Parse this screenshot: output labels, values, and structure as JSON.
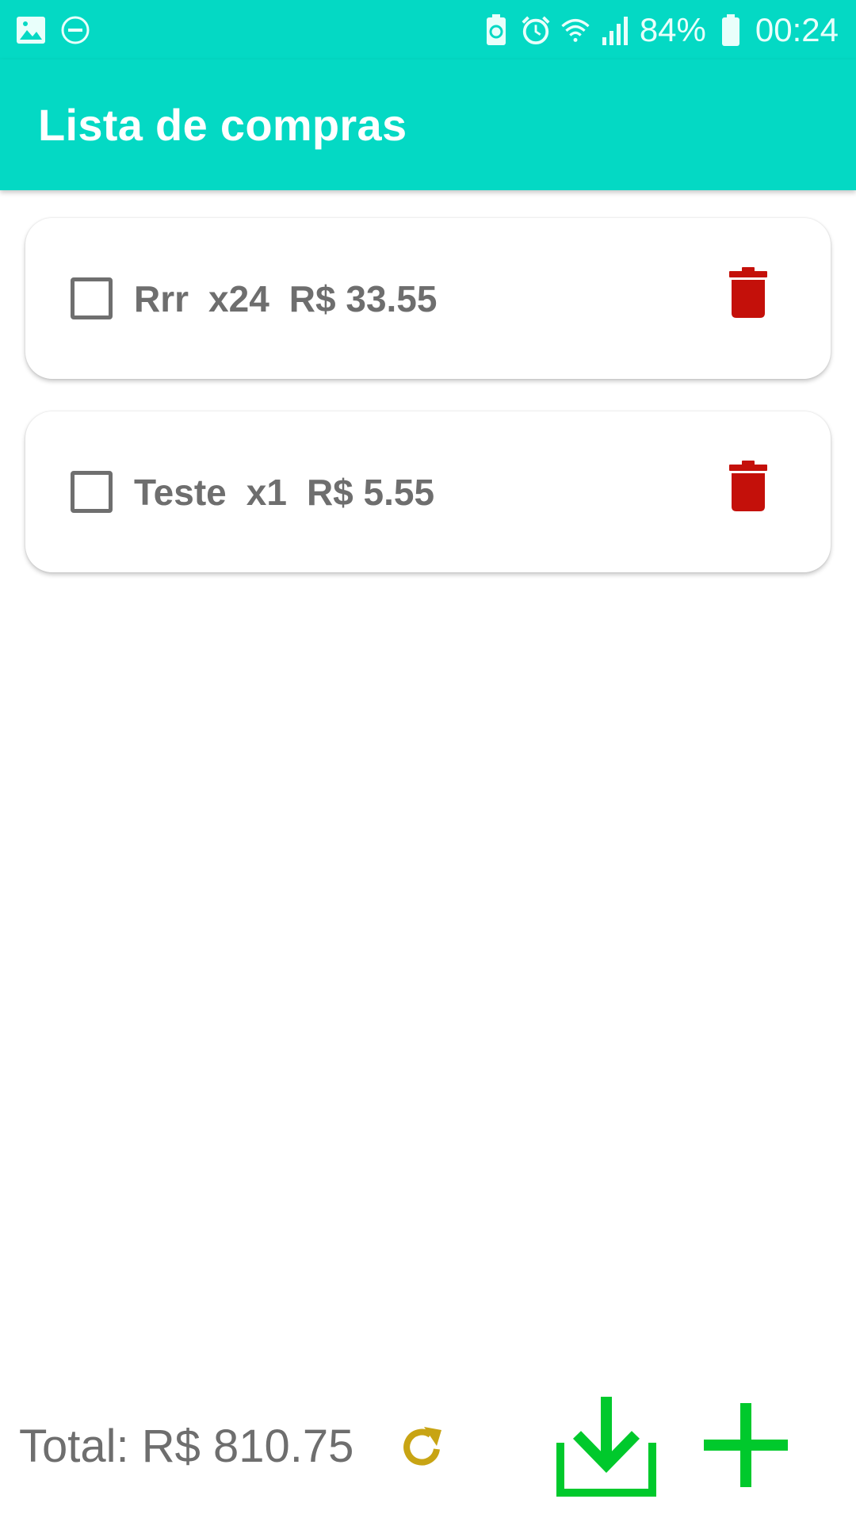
{
  "status_bar": {
    "left_icons": [
      "image-icon",
      "do-not-disturb-icon"
    ],
    "right_icons": [
      "battery-saver-icon",
      "alarm-icon",
      "wifi-icon",
      "signal-icon",
      "battery-icon"
    ],
    "battery": "84%",
    "time": "00:24"
  },
  "app_bar": {
    "title": "Lista de compras"
  },
  "items": [
    {
      "name": "Rrr",
      "quantity": "x24",
      "price": "R$ 33.55",
      "checked": false
    },
    {
      "name": "Teste",
      "quantity": "x1",
      "price": "R$ 5.55",
      "checked": false
    }
  ],
  "footer": {
    "total": "Total: R$ 810.75",
    "icons": [
      "refresh-icon",
      "download-icon",
      "add-icon"
    ]
  },
  "colors": {
    "accent": "#04d9c4",
    "delete": "#c4100a",
    "refresh": "#c8a414",
    "action": "#00c92c",
    "text": "#6e6e6e"
  }
}
